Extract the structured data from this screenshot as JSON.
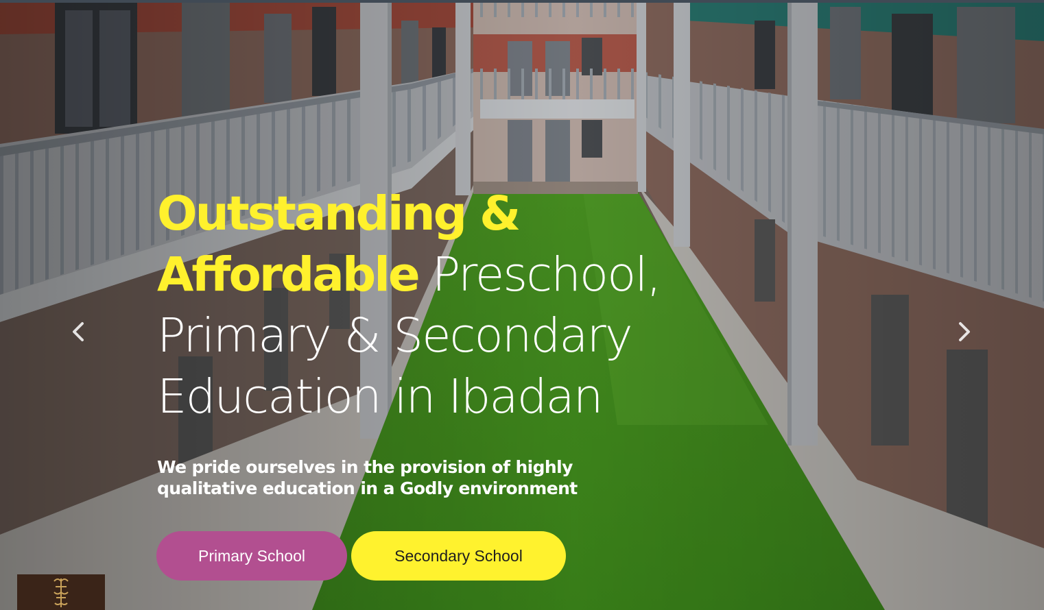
{
  "hero": {
    "headline_highlight": "Outstanding & Affordable",
    "headline_rest_line1": "Preschool,",
    "headline_rest_line2": "Primary & Secondary",
    "headline_rest_line3": "Education in Ibadan",
    "subheading": "We pride ourselves in the provision of highly qualitative education in a Godly environment",
    "buttons": {
      "primary_label": "Primary School",
      "secondary_label": "Secondary School"
    }
  },
  "colors": {
    "highlight": "#fff12d",
    "primary_button": "#b24f90",
    "secondary_button": "#fff22e"
  },
  "icons": {
    "prev": "chevron-left-icon",
    "next": "chevron-right-icon",
    "logo": "school-logo-icon"
  }
}
